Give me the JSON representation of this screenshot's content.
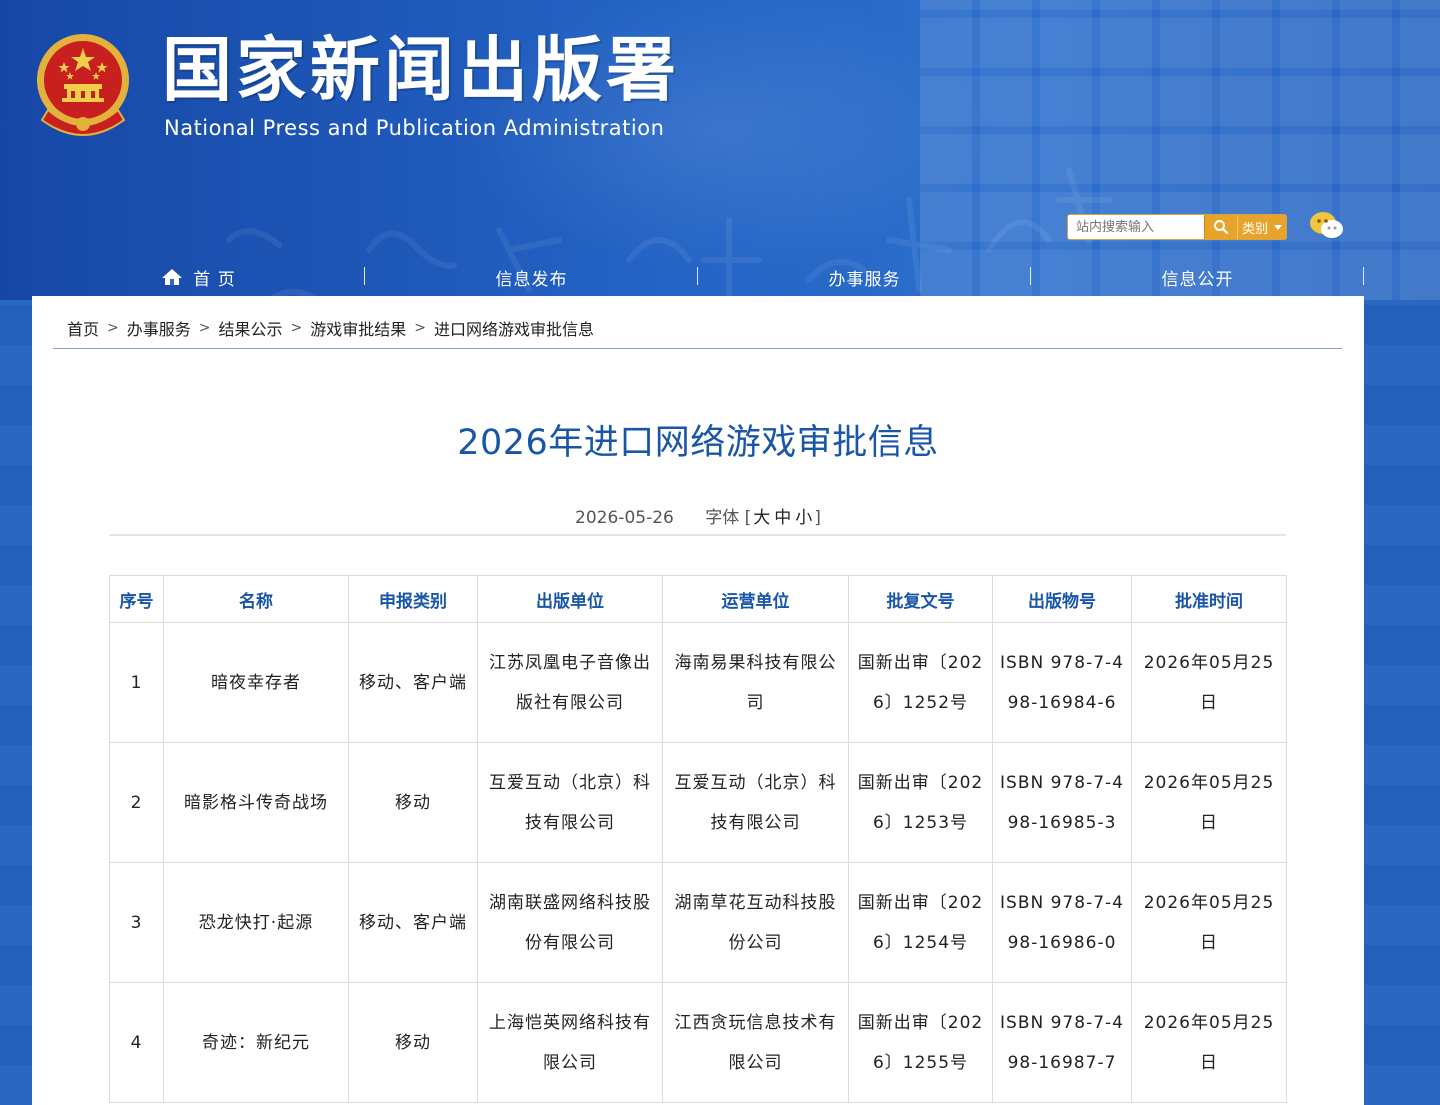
{
  "header": {
    "org_name_cn": "国家新闻出版署",
    "org_name_en": "National  Press and Publication Administration",
    "search_placeholder": "站内搜索输入",
    "category_label": "类别",
    "colors": {
      "banner": "#2363c4",
      "accent": "#e8a42a",
      "title": "#1a56a8"
    }
  },
  "nav": {
    "items": [
      {
        "label": "首 页",
        "icon": "home-icon"
      },
      {
        "label": "信息发布"
      },
      {
        "label": "办事服务"
      },
      {
        "label": "信息公开"
      }
    ]
  },
  "breadcrumb": {
    "items": [
      "首页",
      "办事服务",
      "结果公示",
      "游戏审批结果",
      "进口网络游戏审批信息"
    ],
    "separator": ">"
  },
  "article": {
    "title": "2026年进口网络游戏审批信息",
    "date": "2026-05-26",
    "font_label": "字体 [",
    "font_large": "大",
    "font_medium": "中",
    "font_small": "小",
    "font_close": "]"
  },
  "table": {
    "headers": [
      "序号",
      "名称",
      "申报类别",
      "出版单位",
      "运营单位",
      "批复文号",
      "出版物号",
      "批准时间"
    ],
    "rows": [
      [
        "1",
        "暗夜幸存者",
        "移动、客户端",
        "江苏凤凰电子音像出版社有限公司",
        "海南易果科技有限公司",
        "国新出审〔2026〕1252号",
        "ISBN 978-7-498-16984-6",
        "2026年05月25日"
      ],
      [
        "2",
        "暗影格斗传奇战场",
        "移动",
        "互爱互动（北京）科技有限公司",
        "互爱互动（北京）科技有限公司",
        "国新出审〔2026〕1253号",
        "ISBN 978-7-498-16985-3",
        "2026年05月25日"
      ],
      [
        "3",
        "恐龙快打·起源",
        "移动、客户端",
        "湖南联盛网络科技股份有限公司",
        "湖南草花互动科技股份公司",
        "国新出审〔2026〕1254号",
        "ISBN 978-7-498-16986-0",
        "2026年05月25日"
      ],
      [
        "4",
        "奇迹：新纪元",
        "移动",
        "上海恺英网络科技有限公司",
        "江西贪玩信息技术有限公司",
        "国新出审〔2026〕1255号",
        "ISBN 978-7-498-16987-7",
        "2026年05月25日"
      ]
    ]
  }
}
